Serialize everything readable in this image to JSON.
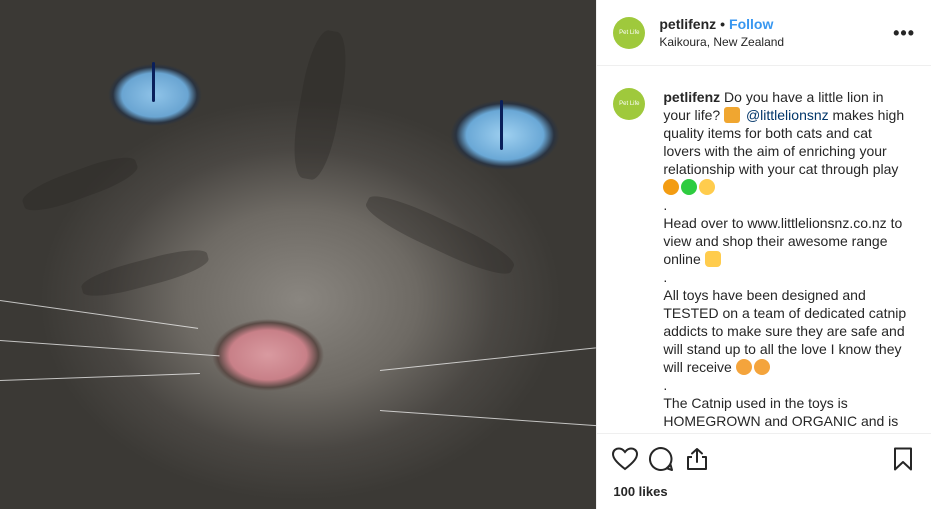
{
  "header": {
    "username": "petlifenz",
    "separator": "•",
    "follow_label": "Follow",
    "location": "Kaikoura, New Zealand",
    "more_label": "•••",
    "avatar_text": "Pet Life"
  },
  "caption": {
    "username": "petlifenz",
    "line1_a": "Do you have a little lion in your life?",
    "mention": "@littlelionsnz",
    "line1_b": "makes high quality items for both cats and cat lovers with the aim of enriching your relationship with your cat through play",
    "dot1": ".",
    "line2": "Head over to www.littlelionsnz.co.nz to view and shop their awesome range online",
    "dot2": ".",
    "line3": "All toys have been designed and TESTED on a team of dedicated catnip addicts to make sure they are safe and will stand up to all the love I know they will receive",
    "dot3": ".",
    "line4": "The Catnip used in the toys is HOMEGROWN and ORGANIC and is more potent that the toys found in pet"
  },
  "footer": {
    "likes": "100 likes"
  },
  "icons": {
    "like": "heart-icon",
    "comment": "comment-icon",
    "share": "share-icon",
    "save": "bookmark-icon"
  },
  "colors": {
    "follow": "#3897f0",
    "avatar_bg": "#9fc93c",
    "mention": "#003569"
  }
}
